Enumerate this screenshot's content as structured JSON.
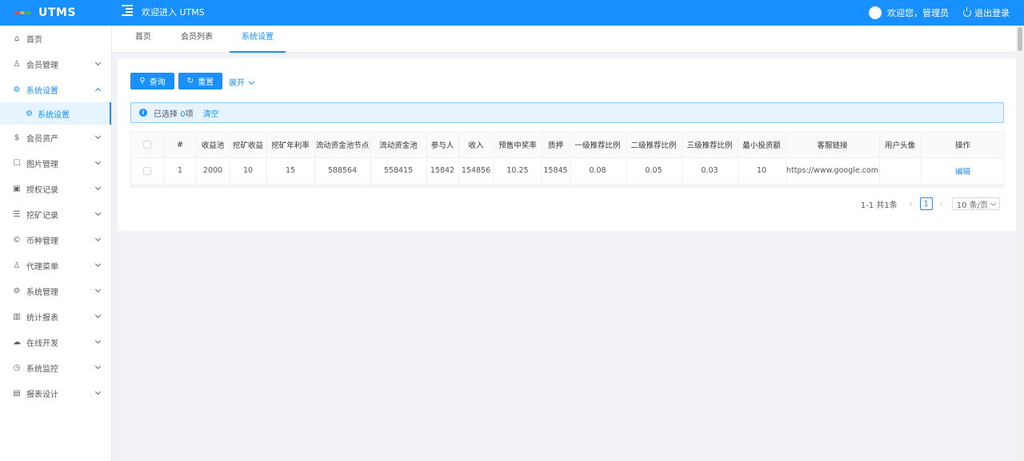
{
  "header": {
    "logo": "UTMS",
    "welcome": "欢迎进入 UTMS",
    "user_greeting": "欢迎您，管理员",
    "logout": "退出登录",
    "colors": {
      "primary": "#1890ff"
    }
  },
  "sidebar": {
    "items": [
      {
        "label": "首页",
        "icon": "home-icon"
      },
      {
        "label": "会员管理",
        "icon": "user-icon"
      },
      {
        "label": "系统设置",
        "icon": "gear-icon"
      },
      {
        "label": "系统设置",
        "icon": "gear-icon"
      },
      {
        "label": "会员资产",
        "icon": "dollar-icon"
      },
      {
        "label": "图片管理",
        "icon": "image-icon"
      },
      {
        "label": "授权记录",
        "icon": "picture-icon"
      },
      {
        "label": "挖矿记录",
        "icon": "list-icon"
      },
      {
        "label": "币种管理",
        "icon": "coin-icon"
      },
      {
        "label": "代理菜单",
        "icon": "user-icon"
      },
      {
        "label": "系统管理",
        "icon": "gear-icon"
      },
      {
        "label": "统计报表",
        "icon": "bar-chart-icon"
      },
      {
        "label": "在线开发",
        "icon": "cloud-icon"
      },
      {
        "label": "系统监控",
        "icon": "monitor-icon"
      },
      {
        "label": "报表设计",
        "icon": "area-chart-icon"
      }
    ]
  },
  "tabs": [
    {
      "label": "首页"
    },
    {
      "label": "会员列表"
    },
    {
      "label": "系统设置"
    }
  ],
  "toolbar": {
    "query": "查询",
    "reset": "重置",
    "expand": "展开"
  },
  "alert": {
    "selected_prefix": "已选择",
    "selected_count": "0",
    "selected_suffix": "项",
    "clear": "清空"
  },
  "table": {
    "columns": [
      "#",
      "收益池",
      "挖矿收益",
      "挖矿年利率",
      "流动资金池节点",
      "流动资金池",
      "参与人",
      "收入",
      "预售中奖率",
      "质押",
      "一级推荐比例",
      "二级推荐比例",
      "三级推荐比例",
      "最小投资额",
      "客服链接",
      "用户头像",
      "操作"
    ],
    "rows": [
      [
        "1",
        "2000",
        "10",
        "15",
        "588564",
        "558415",
        "15842",
        "154856",
        "10.25",
        "15845",
        "0.08",
        "0.05",
        "0.03",
        "10",
        "https://www.google.com",
        "",
        "编辑"
      ]
    ]
  },
  "pagination": {
    "total": "1-1 共1条",
    "page": "1",
    "size": "10 条/页"
  }
}
